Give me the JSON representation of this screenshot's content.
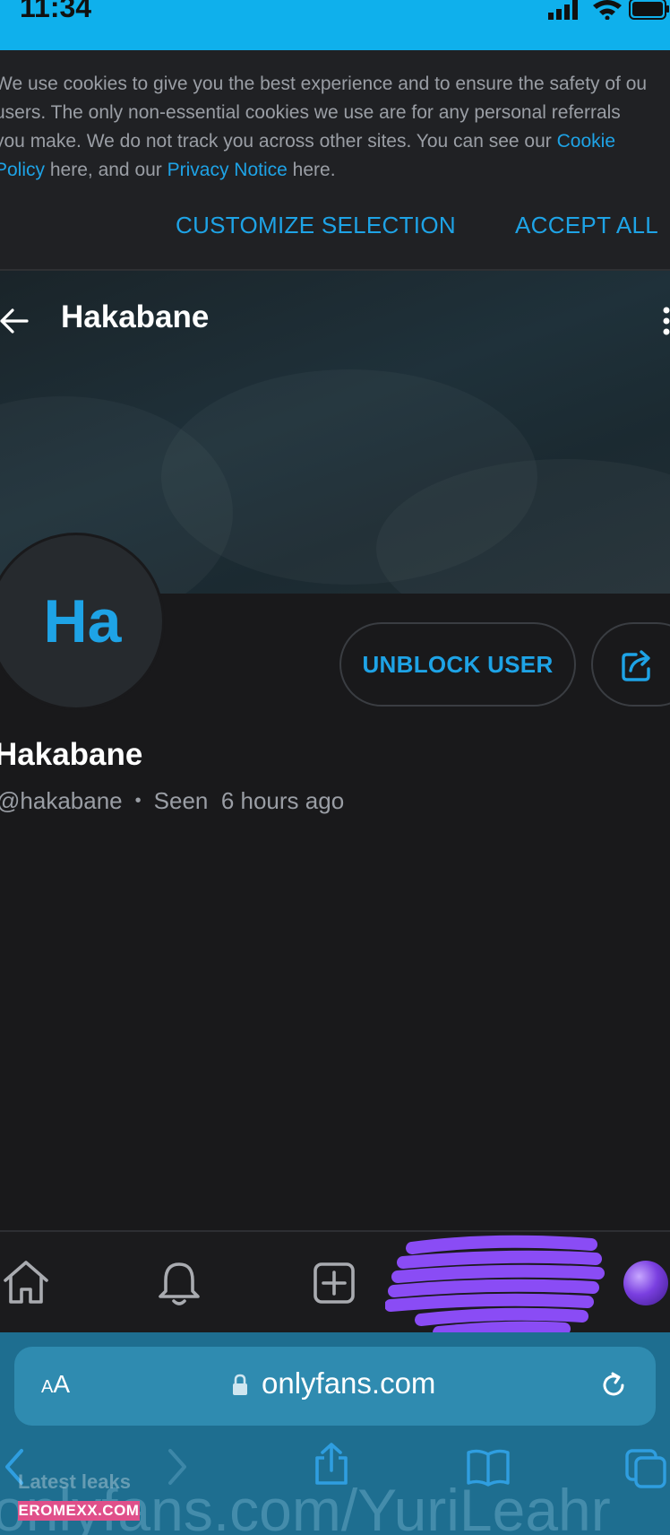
{
  "status_bar": {
    "time": "11:34"
  },
  "cookie_banner": {
    "line1": "We use cookies to give you the best experience and to ensure the safety of ou",
    "line2": "users. The only non-essential cookies we use are for any personal referrals",
    "line3": "you make. We do not track you across other sites. You can see our ",
    "cookie_link_part1": "Cookie",
    "cookie_link_part2": "Policy",
    "mid_text": " here, and our ",
    "privacy_link": "Privacy Notice",
    "end_text": " here.",
    "customize_label": "CUSTOMIZE SELECTION",
    "accept_label": "ACCEPT ALL"
  },
  "profile": {
    "title": "Hakabane",
    "initials": "Ha",
    "display_name": "Hakabane",
    "handle": "@hakabane",
    "separator": "•",
    "seen_label": "Seen",
    "last_seen": "6 hours ago",
    "unblock_label": "UNBLOCK USER"
  },
  "bottom_nav": {
    "icons": [
      "home-icon",
      "bell-icon",
      "add-post-icon",
      "profile-avatar"
    ]
  },
  "browser": {
    "aa_small": "A",
    "aa_large": "A",
    "url": "onlyfans.com",
    "overlay_url": "onlyfans.com/YuriLeahr"
  },
  "watermark": {
    "text": "Latest leaks",
    "badge": "EROMEXX.COM"
  },
  "colors": {
    "accent": "#1ea3e6",
    "status_bar": "#0fb0ec",
    "background": "#19191b",
    "scribble": "#8a4cf5"
  }
}
